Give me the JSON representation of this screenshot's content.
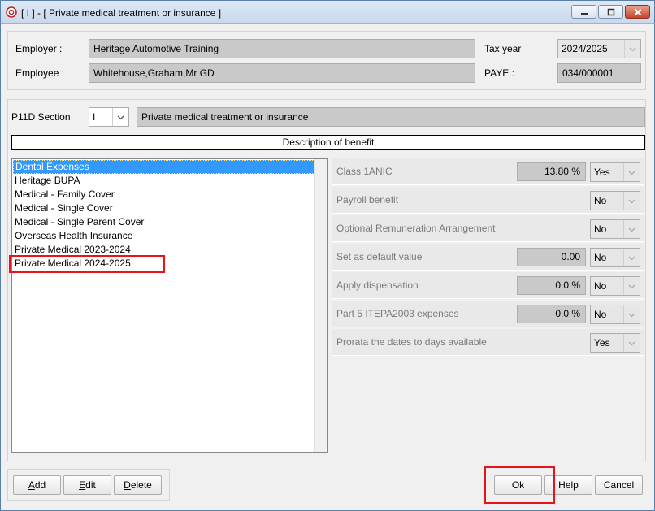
{
  "window": {
    "title": "[ I ] - [ Private medical treatment or insurance ]"
  },
  "header": {
    "employer_label": "Employer :",
    "employer_value": "Heritage Automotive Training",
    "employee_label": "Employee :",
    "employee_value": "Whitehouse,Graham,Mr GD",
    "tax_year_label": "Tax year",
    "tax_year_value": "2024/2025",
    "paye_label": "PAYE :",
    "paye_value": "034/000001"
  },
  "section": {
    "label": "P11D Section",
    "code": "I",
    "name": "Private medical treatment or insurance"
  },
  "description_header": "Description of benefit",
  "benefits": [
    {
      "label": "Dental Expenses",
      "selected": true
    },
    {
      "label": "Heritage BUPA"
    },
    {
      "label": "Medical - Family Cover"
    },
    {
      "label": "Medical - Single Cover"
    },
    {
      "label": "Medical - Single Parent Cover"
    },
    {
      "label": "Overseas Health Insurance"
    },
    {
      "label": "Private Medical 2023-2024"
    },
    {
      "label": "Private Medical 2024-2025"
    }
  ],
  "properties": [
    {
      "label": "Class 1ANIC",
      "value": "13.80 %",
      "option": "Yes"
    },
    {
      "label": "Payroll benefit",
      "option": "No"
    },
    {
      "label": "Optional Remuneration Arrangement",
      "option": "No"
    },
    {
      "label": "Set as default value",
      "value": "0.00",
      "option": "No"
    },
    {
      "label": "Apply dispensation",
      "value": "0.0 %",
      "option": "No"
    },
    {
      "label": "Part 5 ITEPA2003 expenses",
      "value": "0.0 %",
      "option": "No"
    },
    {
      "label": "Prorata the dates to days available",
      "option": "Yes"
    }
  ],
  "buttons": {
    "add": {
      "u": "A",
      "rest": "dd"
    },
    "edit": {
      "u": "E",
      "rest": "dit"
    },
    "delete": {
      "u": "D",
      "rest": "elete"
    },
    "ok": "Ok",
    "help": "Help",
    "cancel": "Cancel"
  },
  "colors": {
    "highlight": "#e8141b",
    "selection": "#3399ff"
  }
}
